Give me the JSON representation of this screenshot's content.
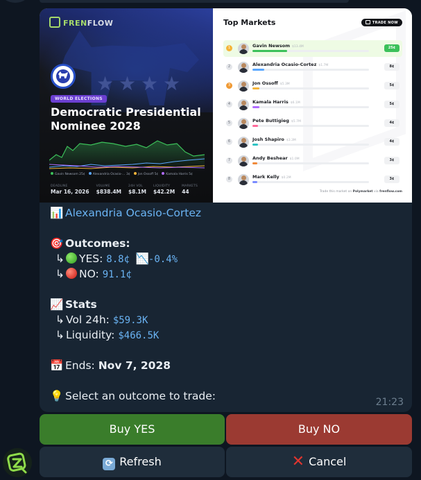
{
  "media": {
    "left": {
      "brand_green": "FREN",
      "brand_white": "FLOW",
      "category": "WORLD ELECTIONS",
      "title": "Democratic Presidential Nominee 2028",
      "legend": [
        {
          "label": "Gavin Newsom 25¢",
          "color": "#3cc15a"
        },
        {
          "label": "Alexandria Ocasio-… 3¢",
          "color": "#5aa7ff"
        },
        {
          "label": "Jon Ossoff 5¢",
          "color": "#f5b53a"
        },
        {
          "label": "Kamala Harris 5¢",
          "color": "#b06bff"
        }
      ],
      "stats": [
        {
          "label": "DEADLINE",
          "value": "Mar 16, 2026"
        },
        {
          "label": "VOLUME",
          "value": "$838.4M"
        },
        {
          "label": "24H VOL",
          "value": "$8.1M"
        },
        {
          "label": "LIQUIDITY",
          "value": "$42.2M"
        },
        {
          "label": "MARKETS",
          "value": "44"
        }
      ]
    },
    "right": {
      "title": "Top Markets",
      "trade_now": "TRADE NOW",
      "rows": [
        {
          "rank": "1",
          "name": "Gavin Newsom",
          "vol": "$13.4M",
          "price": "25¢",
          "fill": 0.3,
          "color": "#3cc15a"
        },
        {
          "rank": "2",
          "name": "Alexandria Ocasio-Cortez",
          "vol": "$1.7M",
          "price": "8¢",
          "fill": 0.1,
          "color": "#5aa7ff"
        },
        {
          "rank": "3",
          "name": "Jon Ossoff",
          "vol": "$5.3M",
          "price": "5¢",
          "fill": 0.06,
          "color": "#f5b53a"
        },
        {
          "rank": "4",
          "name": "Kamala Harris",
          "vol": "$6.1M",
          "price": "5¢",
          "fill": 0.06,
          "color": "#b06bff"
        },
        {
          "rank": "5",
          "name": "Pete Buttigieg",
          "vol": "$5.7M",
          "price": "4¢",
          "fill": 0.05,
          "color": "#ff6a9a"
        },
        {
          "rank": "6",
          "name": "Josh Shapiro",
          "vol": "$3.3M",
          "price": "4¢",
          "fill": 0.05,
          "color": "#2ec4c4"
        },
        {
          "rank": "7",
          "name": "Andy Beshear",
          "vol": "$1.0M",
          "price": "3¢",
          "fill": 0.04,
          "color": "#f08a3a"
        },
        {
          "rank": "8",
          "name": "Mark Kelly",
          "vol": "$0.2M",
          "price": "3¢",
          "fill": 0.04,
          "color": "#7a8bff"
        }
      ],
      "footer_prefix": "Trade this market on",
      "footer_site_a": "Polymarket",
      "footer_via": "via",
      "footer_site_b": "frenflow.com"
    }
  },
  "caption": {
    "candidate_emoji": "📊",
    "candidate": "Alexandria Ocasio-Cortez",
    "outcomes_emoji": "🎯",
    "outcomes_label": "Outcomes:",
    "yes_label": "YES:",
    "yes_price": "8.8¢",
    "yes_change_emoji": "📉",
    "yes_change": "-0.4%",
    "no_label": "NO:",
    "no_price": "91.1¢",
    "stats_emoji": "📈",
    "stats_label": "Stats",
    "vol_label": "Vol 24h:",
    "vol_value": "$59.3K",
    "liq_label": "Liquidity:",
    "liq_value": "$466.5K",
    "ends_emoji": "📅",
    "ends_label": "Ends:",
    "ends_value": "Nov 7, 2028",
    "prompt_emoji": "💡",
    "prompt": "Select an outcome to trade:",
    "sub_arrow": "↳",
    "time": "21:23"
  },
  "buttons": {
    "buy_yes": "Buy YES",
    "buy_no": "Buy NO",
    "refresh": "Refresh",
    "cancel": "Cancel"
  },
  "colors": {
    "yes": "#3a7d2b",
    "no": "#9b3a32",
    "link": "#6ab3f3",
    "bubble": "#182533"
  }
}
